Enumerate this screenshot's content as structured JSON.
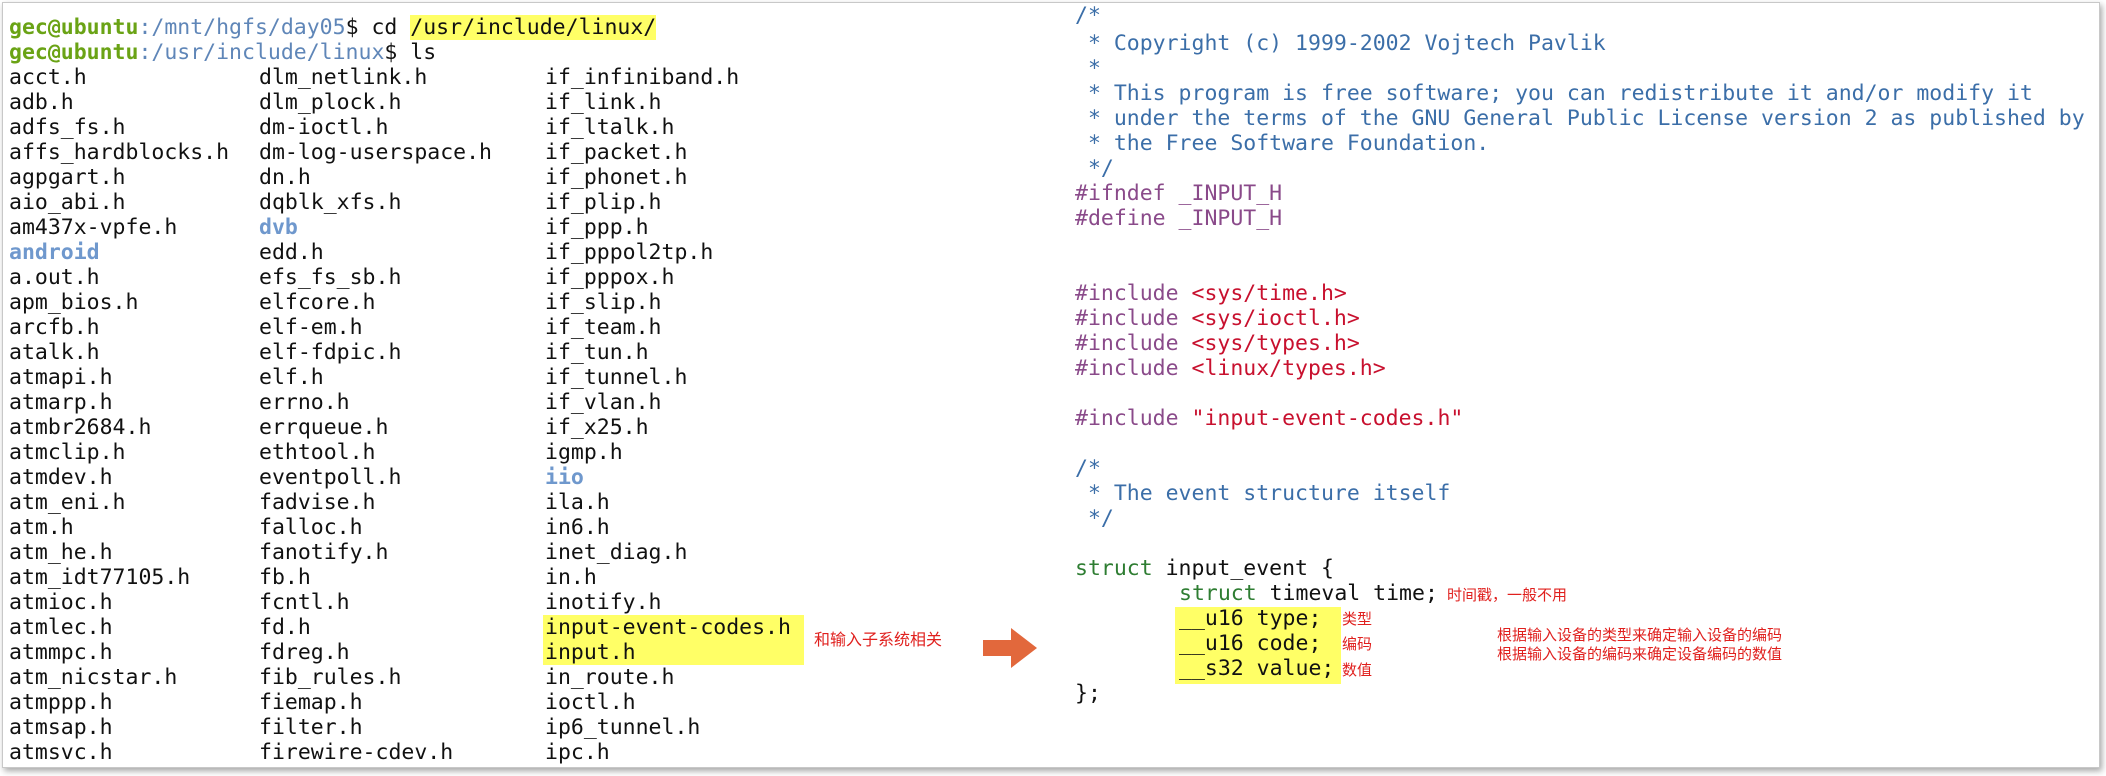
{
  "terminal": {
    "prompt1": {
      "user": "gec@ubuntu",
      "path": ":/mnt/hgfs/day05",
      "symbol": "$ ",
      "cmd": "cd ",
      "arg": "/usr/include/linux/"
    },
    "prompt2": {
      "user": "gec@ubuntu",
      "path": ":/usr/include/linux",
      "symbol": "$ ",
      "cmd": "ls"
    },
    "col1": [
      "acct.h",
      "adb.h",
      "adfs_fs.h",
      "affs_hardblocks.h",
      "agpgart.h",
      "aio_abi.h",
      "am437x-vpfe.h",
      "android",
      "a.out.h",
      "apm_bios.h",
      "arcfb.h",
      "atalk.h",
      "atmapi.h",
      "atmarp.h",
      "atmbr2684.h",
      "atmclip.h",
      "atmdev.h",
      "atm_eni.h",
      "atm.h",
      "atm_he.h",
      "atm_idt77105.h",
      "atmioc.h",
      "atmlec.h",
      "atmmpc.h",
      "atm_nicstar.h",
      "atmppp.h",
      "atmsap.h",
      "atmsvc.h"
    ],
    "col2": [
      "dlm_netlink.h",
      "dlm_plock.h",
      "dm-ioctl.h",
      "dm-log-userspace.h",
      "dn.h",
      "dqblk_xfs.h",
      "dvb",
      "edd.h",
      "efs_fs_sb.h",
      "elfcore.h",
      "elf-em.h",
      "elf-fdpic.h",
      "elf.h",
      "errno.h",
      "errqueue.h",
      "ethtool.h",
      "eventpoll.h",
      "fadvise.h",
      "falloc.h",
      "fanotify.h",
      "fb.h",
      "fcntl.h",
      "fd.h",
      "fdreg.h",
      "fib_rules.h",
      "fiemap.h",
      "filter.h",
      "firewire-cdev.h"
    ],
    "col3": [
      "if_infiniband.h",
      "if_link.h",
      "if_ltalk.h",
      "if_packet.h",
      "if_phonet.h",
      "if_plip.h",
      "if_ppp.h",
      "if_pppol2tp.h",
      "if_pppox.h",
      "if_slip.h",
      "if_team.h",
      "if_tun.h",
      "if_tunnel.h",
      "if_vlan.h",
      "if_x25.h",
      "igmp.h",
      "iio",
      "ila.h",
      "in6.h",
      "inet_diag.h",
      "in.h",
      "inotify.h",
      "input-event-codes.h",
      "input.h",
      "in_route.h",
      "ioctl.h",
      "ip6_tunnel.h",
      "ipc.h"
    ],
    "annotation": "和输入子系统相关"
  },
  "code": {
    "lines": [
      "/*",
      " * Copyright (c) 1999-2002 Vojtech Pavlik",
      " *",
      " * This program is free software; you can redistribute it and/or modify it",
      " * under the terms of the GNU General Public License version 2 as published by",
      " * the Free Software Foundation.",
      " */",
      "#ifndef _INPUT_H",
      "#define _INPUT_H"
    ],
    "inc1": {
      "kw": "#include ",
      "file": "<sys/time.h>"
    },
    "inc2": {
      "kw": "#include ",
      "file": "<sys/ioctl.h>"
    },
    "inc3": {
      "kw": "#include ",
      "file": "<sys/types.h>"
    },
    "inc4": {
      "kw": "#include ",
      "file": "<linux/types.h>"
    },
    "inc5": {
      "kw": "#include ",
      "file": "\"input-event-codes.h\""
    },
    "cmt2": [
      "/*",
      " * The event structure itself",
      " */"
    ],
    "struct_kw": "struct",
    "struct_name": " input_event {",
    "field_time_kw": "struct",
    "field_time_rest": " timeval time;",
    "field_type": "__u16 type;",
    "field_code": "__u16 code;",
    "field_value": "__s32 value;",
    "close": "};",
    "notes": {
      "time": "时间戳，一般不用",
      "type": "类型",
      "code": "编码",
      "value": "数值",
      "explain1": "根据输入设备的类型来确定输入设备的编码",
      "explain2": "根据输入设备的编码来确定设备编码的数值"
    }
  },
  "colors": {
    "prompt_user": "#6aa315",
    "prompt_path": "#5f86b8",
    "highlight": "#ffff66",
    "arrow": "#e2683c",
    "note": "#e0201e"
  }
}
